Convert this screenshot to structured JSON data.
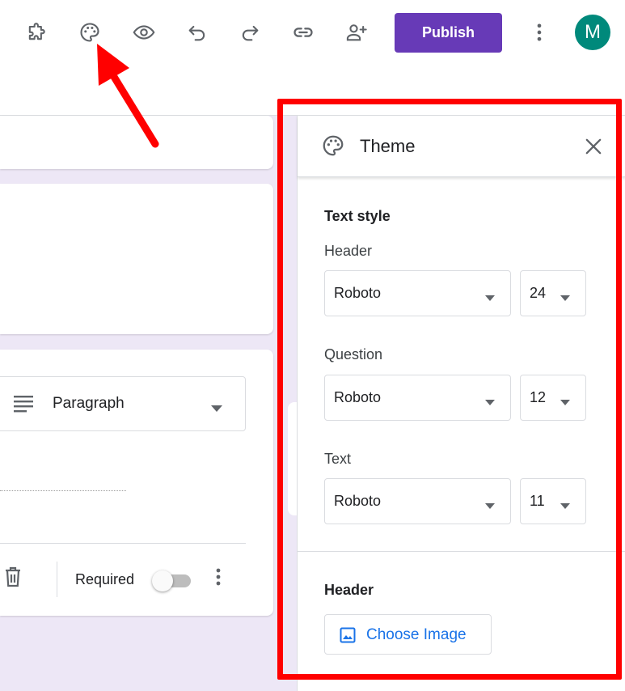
{
  "toolbar": {
    "publish_label": "Publish",
    "avatar_initial": "M"
  },
  "question": {
    "type_label": "Paragraph",
    "required_label": "Required",
    "required_on": false
  },
  "theme_panel": {
    "title": "Theme",
    "text_style_heading": "Text style",
    "header_label": "Header",
    "header_font": "Roboto",
    "header_size": "24",
    "question_label": "Question",
    "question_font": "Roboto",
    "question_size": "12",
    "text_label": "Text",
    "text_font": "Roboto",
    "text_size": "11",
    "header_section_heading": "Header",
    "choose_image_label": "Choose Image"
  },
  "colors": {
    "accent": "#673ab7",
    "avatar": "#00897b",
    "canvas": "#ede7f6",
    "link": "#1a73e8",
    "annotation": "#ff0000"
  }
}
